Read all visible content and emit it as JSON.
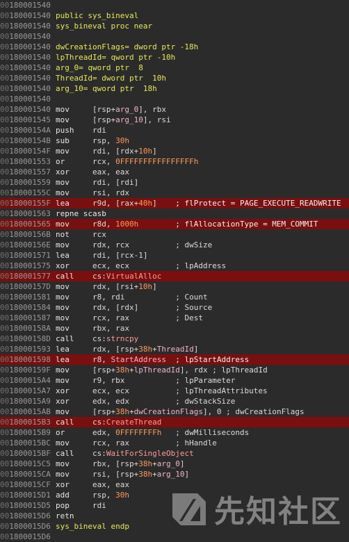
{
  "address_prefix": "00",
  "lines": [
    {
      "addr": "180001540",
      "code": "",
      "highlight": false
    },
    {
      "addr": "180001540",
      "code": "public sys_bineval",
      "kind": "decl",
      "highlight": false
    },
    {
      "addr": "180001540",
      "code": "sys_bineval proc near",
      "kind": "decl",
      "highlight": false
    },
    {
      "addr": "180001540",
      "code": "",
      "highlight": false
    },
    {
      "addr": "180001540",
      "code": "dwCreationFlags= dword ptr -18h",
      "kind": "decl",
      "highlight": false
    },
    {
      "addr": "180001540",
      "code": "lpThreadId= qword ptr -10h",
      "kind": "decl",
      "highlight": false
    },
    {
      "addr": "180001540",
      "code": "arg_0= qword ptr  8",
      "kind": "decl",
      "highlight": false
    },
    {
      "addr": "180001540",
      "code": "ThreadId= dword ptr  10h",
      "kind": "decl",
      "highlight": false
    },
    {
      "addr": "180001540",
      "code": "arg_10= qword ptr  18h",
      "kind": "decl",
      "highlight": false
    },
    {
      "addr": "180001540",
      "code": "",
      "highlight": false
    },
    {
      "addr": "180001540",
      "mnem": "mov",
      "ops": "[rsp+arg_0], rbx",
      "comment": "",
      "highlight": false
    },
    {
      "addr": "180001545",
      "mnem": "mov",
      "ops": "[rsp+arg_10], rsi",
      "comment": "",
      "highlight": false
    },
    {
      "addr": "18000154A",
      "mnem": "push",
      "ops": "rdi",
      "comment": "",
      "highlight": false
    },
    {
      "addr": "18000154B",
      "mnem": "sub",
      "ops": "rsp, 30h",
      "comment": "",
      "highlight": false
    },
    {
      "addr": "18000154F",
      "mnem": "mov",
      "ops": "rdi, [rdx+10h]",
      "comment": "",
      "highlight": false
    },
    {
      "addr": "180001553",
      "mnem": "or",
      "ops": "rcx, 0FFFFFFFFFFFFFFFFh",
      "comment": "",
      "highlight": false
    },
    {
      "addr": "180001557",
      "mnem": "xor",
      "ops": "eax, eax",
      "comment": "",
      "highlight": false
    },
    {
      "addr": "180001559",
      "mnem": "mov",
      "ops": "rdi, [rdi]",
      "comment": "",
      "highlight": false
    },
    {
      "addr": "18000155C",
      "mnem": "mov",
      "ops": "rsi, rdx",
      "comment": "",
      "highlight": false
    },
    {
      "addr": "18000155F",
      "mnem": "lea",
      "ops": "r9d, [rax+40h]",
      "comment": "; flProtect = PAGE_EXECUTE_READWRITE",
      "highlight": true
    },
    {
      "addr": "180001563",
      "mnem": "repne scasb",
      "ops": "",
      "comment": "",
      "highlight": false
    },
    {
      "addr": "180001565",
      "mnem": "mov",
      "ops": "r8d, 1000h",
      "comment": "; flAllocationType = MEM_COMMIT",
      "highlight": true
    },
    {
      "addr": "18000156B",
      "mnem": "not",
      "ops": "rcx",
      "comment": "",
      "highlight": false
    },
    {
      "addr": "18000156E",
      "mnem": "mov",
      "ops": "rdx, rcx",
      "comment": "; dwSize",
      "highlight": false
    },
    {
      "addr": "180001571",
      "mnem": "lea",
      "ops": "rdi, [rcx-1]",
      "comment": "",
      "highlight": false
    },
    {
      "addr": "180001575",
      "mnem": "xor",
      "ops": "ecx, ecx",
      "comment": "; lpAddress",
      "highlight": false
    },
    {
      "addr": "180001577",
      "mnem": "call",
      "ops": "cs:VirtualAlloc",
      "comment": "",
      "highlight": true
    },
    {
      "addr": "18000157D",
      "mnem": "mov",
      "ops": "rdx, [rsi+10h]",
      "comment": "",
      "highlight": false
    },
    {
      "addr": "180001581",
      "mnem": "mov",
      "ops": "r8, rdi",
      "comment": "; Count",
      "highlight": false
    },
    {
      "addr": "180001584",
      "mnem": "mov",
      "ops": "rdx, [rdx]",
      "comment": "; Source",
      "highlight": false
    },
    {
      "addr": "180001587",
      "mnem": "mov",
      "ops": "rcx, rax",
      "comment": "; Dest",
      "highlight": false
    },
    {
      "addr": "18000158A",
      "mnem": "mov",
      "ops": "rbx, rax",
      "comment": "",
      "highlight": false
    },
    {
      "addr": "18000158D",
      "mnem": "call",
      "ops": "cs:strncpy",
      "comment": "",
      "highlight": false
    },
    {
      "addr": "180001593",
      "mnem": "lea",
      "ops": "rdx, [rsp+38h+ThreadId]",
      "comment": "",
      "highlight": false
    },
    {
      "addr": "180001598",
      "mnem": "lea",
      "ops": "r8, StartAddress",
      "comment": "; lpStartAddress",
      "highlight": true
    },
    {
      "addr": "18000159F",
      "mnem": "mov",
      "ops": "[rsp+38h+lpThreadId], rdx",
      "comment": "; lpThreadId",
      "highlight": false
    },
    {
      "addr": "1800015A4",
      "mnem": "mov",
      "ops": "r9, rbx",
      "comment": "; lpParameter",
      "highlight": false
    },
    {
      "addr": "1800015A7",
      "mnem": "xor",
      "ops": "ecx, ecx",
      "comment": "; lpThreadAttributes",
      "highlight": false
    },
    {
      "addr": "1800015A9",
      "mnem": "xor",
      "ops": "edx, edx",
      "comment": "; dwStackSize",
      "highlight": false
    },
    {
      "addr": "1800015AB",
      "mnem": "mov",
      "ops": "[rsp+38h+dwCreationFlags], 0",
      "comment": "; dwCreationFlags",
      "highlight": false
    },
    {
      "addr": "1800015B3",
      "mnem": "call",
      "ops": "cs:CreateThread",
      "comment": "",
      "highlight": true
    },
    {
      "addr": "1800015B9",
      "mnem": "or",
      "ops": "edx, 0FFFFFFFFh",
      "comment": "; dwMilliseconds",
      "highlight": false
    },
    {
      "addr": "1800015BC",
      "mnem": "mov",
      "ops": "rcx, rax",
      "comment": "; hHandle",
      "highlight": false
    },
    {
      "addr": "1800015BF",
      "mnem": "call",
      "ops": "cs:WaitForSingleObject",
      "comment": "",
      "highlight": false
    },
    {
      "addr": "1800015C5",
      "mnem": "mov",
      "ops": "rbx, [rsp+38h+arg_0]",
      "comment": "",
      "highlight": false
    },
    {
      "addr": "1800015CA",
      "mnem": "mov",
      "ops": "rsi, [rsp+38h+arg_10]",
      "comment": "",
      "highlight": false
    },
    {
      "addr": "1800015CF",
      "mnem": "xor",
      "ops": "eax, eax",
      "comment": "",
      "highlight": false
    },
    {
      "addr": "1800015D1",
      "mnem": "add",
      "ops": "rsp, 30h",
      "comment": "",
      "highlight": false
    },
    {
      "addr": "1800015D5",
      "mnem": "pop",
      "ops": "rdi",
      "comment": "",
      "highlight": false
    },
    {
      "addr": "1800015D6",
      "mnem": "retn",
      "ops": "",
      "comment": "",
      "highlight": false
    },
    {
      "addr": "1800015D6",
      "code": "sys_bineval endp",
      "kind": "decl",
      "highlight": false
    },
    {
      "addr": "1800015D6",
      "code": "",
      "highlight": false
    }
  ],
  "watermark": {
    "text": "先知社区",
    "icon": "xianzhi-logo-icon"
  },
  "colors": {
    "background": "#2b2b2b",
    "highlight_row": "#7a0f0f",
    "address": "#9a9a9a",
    "keyword": "#e9e957",
    "number": "#ff9a5a"
  }
}
